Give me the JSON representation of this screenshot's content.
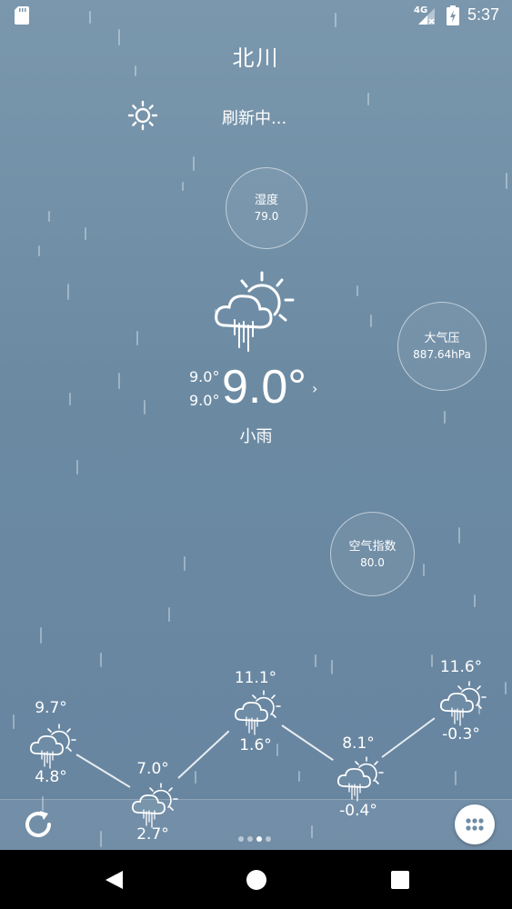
{
  "status_bar": {
    "network": "4G",
    "time": "5:37"
  },
  "city": "北川",
  "refresh_text": "刷新中...",
  "humidity": {
    "label": "湿度",
    "value": "79.0"
  },
  "pressure": {
    "label": "大气压",
    "value": "887.64hPa"
  },
  "aqi": {
    "label": "空气指数",
    "value": "80.0"
  },
  "current": {
    "temp_high": "9.0°",
    "temp_low": "9.0°",
    "temp": "9.0°",
    "chevron": "›",
    "condition": "小雨"
  },
  "forecast": [
    {
      "high": "9.7°",
      "low": "4.8°",
      "icon": "cloud-sun-rain-icon"
    },
    {
      "high": "7.0°",
      "low": "2.7°",
      "icon": "cloud-sun-rain-icon"
    },
    {
      "high": "11.1°",
      "low": "1.6°",
      "icon": "cloud-sun-rain-icon"
    },
    {
      "high": "8.1°",
      "low": "-0.4°",
      "icon": "cloud-sun-rain-icon"
    },
    {
      "high": "11.6°",
      "low": "-0.3°",
      "icon": "cloud-sun-rain-icon"
    }
  ],
  "pager": {
    "count": 4,
    "active": 2
  },
  "colors": {
    "accent": "#ffffff",
    "bg_top": "#7a97ad",
    "bg_bottom": "#6784a0",
    "nav": "#000000"
  }
}
